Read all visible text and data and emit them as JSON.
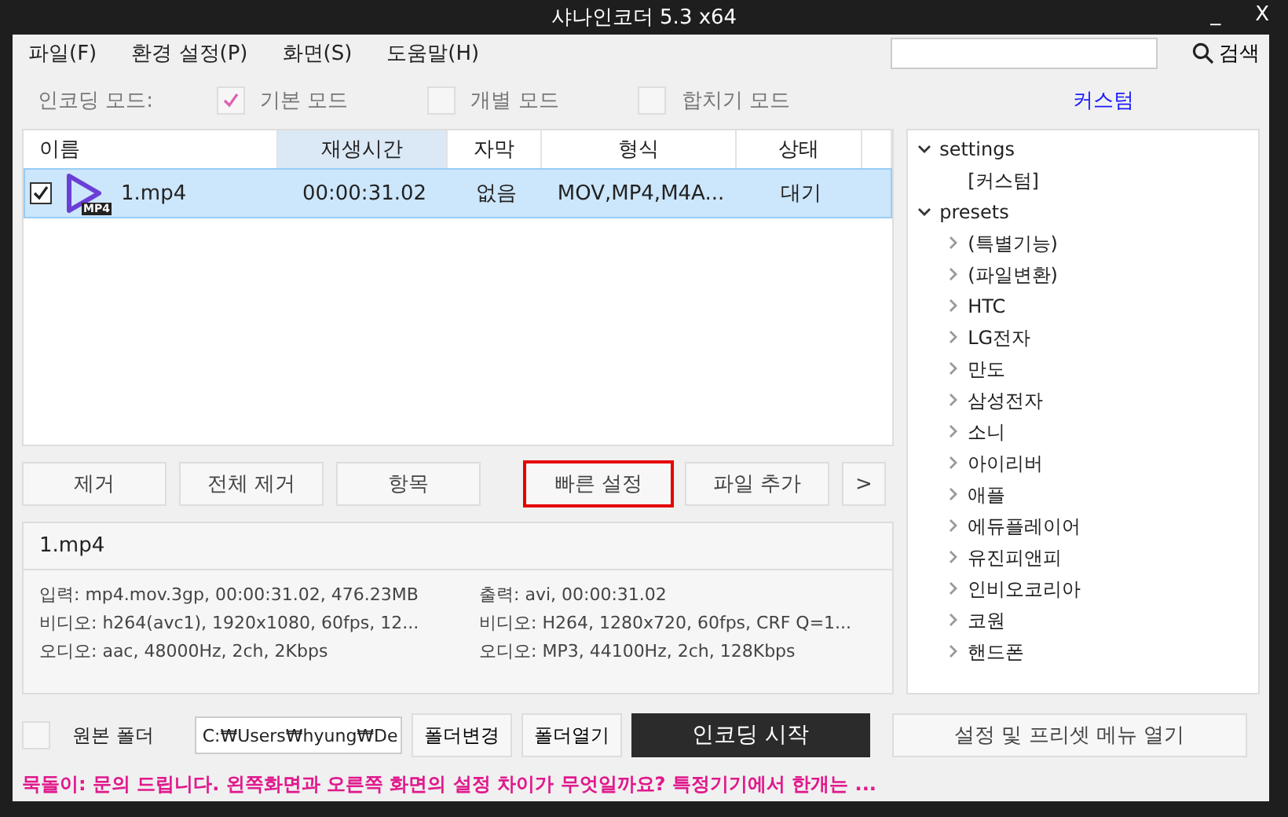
{
  "window": {
    "title": "샤나인코더  5.3  x64",
    "controls": [
      "_",
      "X"
    ]
  },
  "menu": [
    {
      "label": "파일(F)"
    },
    {
      "label": "환경 설정(P)"
    },
    {
      "label": "화면(S)"
    },
    {
      "label": "도움말(H)"
    }
  ],
  "search": {
    "button": "검색"
  },
  "mode": {
    "label": "인코딩 모드:",
    "options": [
      {
        "label": "기본 모드",
        "checked": true
      },
      {
        "label": "개별 모드",
        "checked": false
      },
      {
        "label": "합치기 모드",
        "checked": false
      }
    ],
    "preset_name": "커스텀"
  },
  "table": {
    "columns": [
      {
        "label": "이름",
        "sorted": false
      },
      {
        "label": "재생시간",
        "sorted": true
      },
      {
        "label": "자막",
        "sorted": false
      },
      {
        "label": "형식",
        "sorted": false
      },
      {
        "label": "상태",
        "sorted": false
      }
    ],
    "rows": [
      {
        "checked": true,
        "selected": true,
        "badge": "MP4",
        "cells": [
          "1.mp4",
          "00:00:31.02",
          "없음",
          "MOV,MP4,M4A...",
          "대기"
        ]
      }
    ]
  },
  "buttons": [
    {
      "label": "제거",
      "highlighted": false
    },
    {
      "label": "전체 제거",
      "highlighted": false
    },
    {
      "label": "항목",
      "highlighted": false
    },
    {
      "label": "빠른 설정",
      "highlighted": true
    },
    {
      "label": "파일 추가",
      "highlighted": false
    },
    {
      "label": ">",
      "highlighted": false
    }
  ],
  "info": {
    "file": "1.mp4",
    "input": [
      "입력: mp4.mov.3gp, 00:00:31.02, 476.23MB",
      "비디오: h264(avc1), 1920x1080, 60fps, 12...",
      "오디오: aac, 48000Hz, 2ch, 2Kbps"
    ],
    "output": [
      "출력: avi, 00:00:31.02",
      "비디오: H264, 1280x720, 60fps, CRF Q=1...",
      "오디오: MP3, 44100Hz, 2ch, 128Kbps"
    ]
  },
  "tree": [
    {
      "label": "settings",
      "expanded": true,
      "children": [
        {
          "label": "[커스텀]"
        }
      ]
    },
    {
      "label": "presets",
      "expanded": true,
      "children": [
        {
          "label": "(특별기능)",
          "expanded": false
        },
        {
          "label": "(파일변환)",
          "expanded": false
        },
        {
          "label": "HTC",
          "expanded": false
        },
        {
          "label": "LG전자",
          "expanded": false
        },
        {
          "label": "만도",
          "expanded": false
        },
        {
          "label": "삼성전자",
          "expanded": false
        },
        {
          "label": "소니",
          "expanded": false
        },
        {
          "label": "아이리버",
          "expanded": false
        },
        {
          "label": "애플",
          "expanded": false
        },
        {
          "label": "에듀플레이어",
          "expanded": false
        },
        {
          "label": "유진피앤피",
          "expanded": false
        },
        {
          "label": "인비오코리아",
          "expanded": false
        },
        {
          "label": "코원",
          "expanded": false
        },
        {
          "label": "핸드폰",
          "expanded": false
        }
      ]
    }
  ],
  "output": {
    "source_folder": {
      "label": "원본 폴더",
      "checked": false
    },
    "path": "C:₩Users₩hyung₩De",
    "change": "폴더변경",
    "open": "폴더열기",
    "start": "인코딩 시작",
    "menu": "설정 및 프리셋 메뉴 열기"
  },
  "status": "묵돌이: 문의 드립니다. 왼쪽화면과 오른쪽 화면의 설정 차이가 무엇일까요? 특정기기에서 한개는 ..."
}
